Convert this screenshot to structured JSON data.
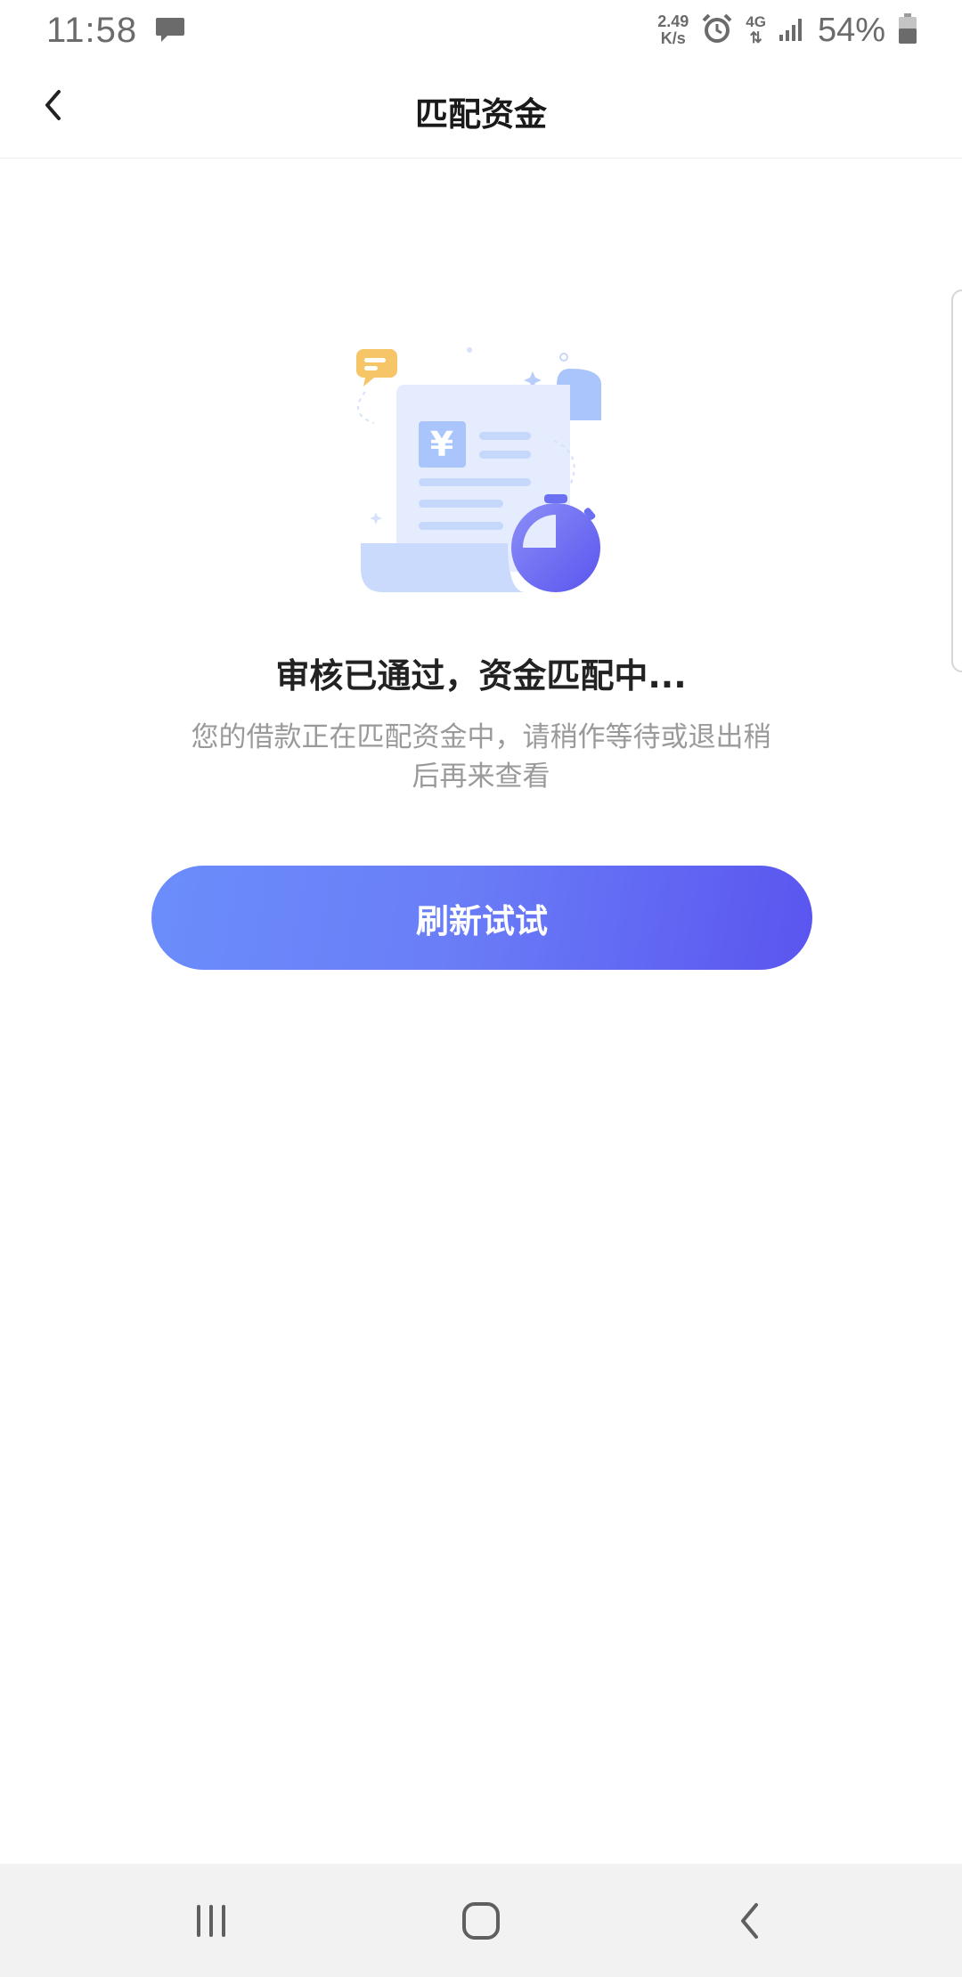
{
  "status_bar": {
    "time": "11:58",
    "speed_value": "2.49",
    "speed_unit": "K/s",
    "network": "4G",
    "battery": "54%",
    "icons": [
      "message-icon",
      "alarm-icon",
      "signal-icon",
      "battery-icon"
    ]
  },
  "app_bar": {
    "title": "匹配资金",
    "back_icon": "chevron-left-icon"
  },
  "main": {
    "headline": "审核已通过，资金匹配中...",
    "description": "您的借款正在匹配资金中，请稍作等待或退出稍后再来查看",
    "refresh_label": "刷新试试",
    "illustration": "document-stopwatch-illustration"
  },
  "nav_bar": {
    "items": [
      "recent-apps-icon",
      "home-icon",
      "back-icon"
    ]
  },
  "colors": {
    "accent_start": "#6b8dfb",
    "accent_end": "#5a55ef",
    "title_text": "#1a1a1a",
    "secondary_text": "#9a9a9a"
  }
}
